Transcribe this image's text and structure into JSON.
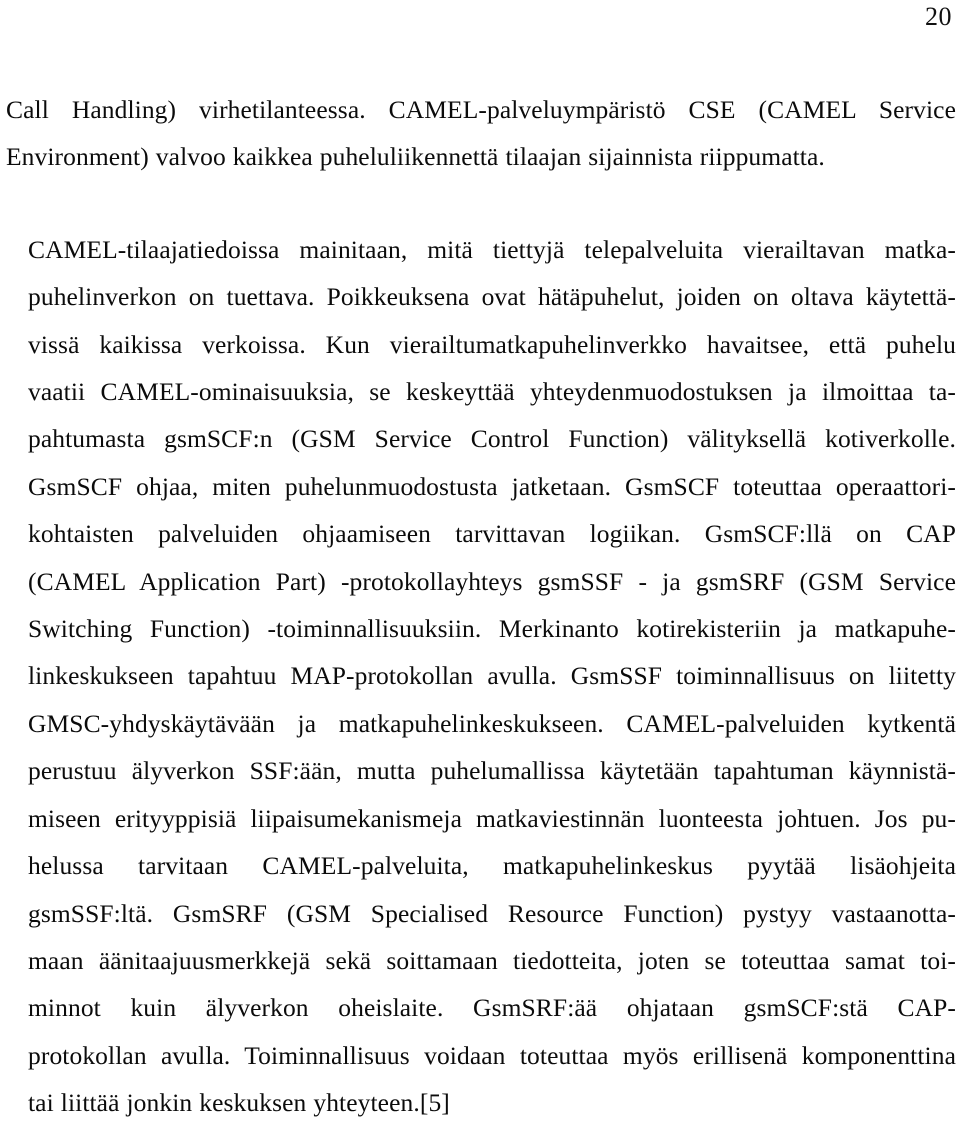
{
  "document": {
    "page_number": "20",
    "language": "fi",
    "paragraphs": [
      {
        "id": "para-1",
        "indented": false,
        "lines": [
          "Call Handling) virhetilanteessa. CAMEL-palveluympäristö CSE (CAMEL Service",
          "Environment) valvoo kaikkea puheluliikennettä tilaajan sijainnista riippumatta."
        ],
        "text": "Call Handling) virhetilanteessa. CAMEL-palveluympäristö CSE (CAMEL Service Environment) valvoo kaikkea puheluliikennettä tilaajan sijainnista riippumatta."
      },
      {
        "id": "para-2",
        "indented": true,
        "lines": [
          "CAMEL-tilaajatiedoissa mainitaan, mitä tiettyjä telepalveluita vierailtavan matka-",
          "puhelinverkon on tuettava. Poikkeuksena ovat hätäpuhelut, joiden on oltava käytettä-",
          "vissä kaikissa verkoissa. Kun vierailtumatkapuhelinverkko havaitsee, että puhelu",
          "vaatii CAMEL-ominaisuuksia, se keskeyttää yhteydenmuodostuksen ja ilmoittaa ta-",
          "pahtumasta gsmSCF:n (GSM Service Control Function) välityksellä kotiverkolle.",
          "GsmSCF ohjaa, miten puhelunmuodostusta jatketaan. GsmSCF toteuttaa operaattori-",
          "kohtaisten palveluiden ohjaamiseen tarvittavan logiikan. GsmSCF:llä on CAP",
          "(CAMEL Application Part) -protokollayhteys gsmSSF - ja gsmSRF (GSM Service",
          "Switching Function) -toiminnallisuuksiin. Merkinanto kotirekisteriin ja matkapuhe-",
          "linkeskukseen tapahtuu MAP-protokollan avulla. GsmSSF toiminnallisuus on liitetty",
          "GMSC-yhdyskäytävään ja matkapuhelinkeskukseen. CAMEL-palveluiden kytkentä",
          "perustuu älyverkon SSF:ään, mutta puhelumallissa käytetään tapahtuman käynnistä-",
          "miseen erityyppisiä liipaisumekanismeja matkaviestinnän luonteesta johtuen. Jos pu-",
          "helussa tarvitaan CAMEL-palveluita, matkapuhelinkeskus pyytää lisäohjeita",
          "gsmSSF:ltä. GsmSRF (GSM Specialised Resource Function) pystyy vastaanotta-",
          "maan äänitaajuusmerkkejä sekä soittamaan tiedotteita, joten se toteuttaa samat toi-",
          "minnot kuin älyverkon oheislaite. GsmSRF:ää ohjataan gsmSCF:stä CAP-",
          "protokollan avulla. Toiminnallisuus voidaan toteuttaa myös erillisenä komponenttina",
          "tai liittää jonkin keskuksen yhteyteen.[5]"
        ],
        "text": "CAMEL-tilaajatiedoissa mainitaan, mitä tiettyjä telepalveluita vierailtavan matkapuhelinverkon on tuettava. Poikkeuksena ovat hätäpuhelut, joiden on oltava käytettävissä kaikissa verkoissa. Kun vierailtumatkapuhelinverkko havaitsee, että puhelu vaatii CAMEL-ominaisuuksia, se keskeyttää yhteydenmuodostuksen ja ilmoittaa tapahtumasta gsmSCF:n (GSM Service Control Function) välityksellä kotiverkolle. GsmSCF ohjaa, miten puhelunmuodostusta jatketaan. GsmSCF toteuttaa operaattorikohtaisten palveluiden ohjaamiseen tarvittavan logiikan. GsmSCF:llä on CAP (CAMEL Application Part) -protokollayhteys gsmSSF - ja gsmSRF (GSM Service Switching Function) -toiminnallisuuksiin. Merkinanto kotirekisteriin ja matkapuhelinkeskukseen tapahtuu MAP-protokollan avulla. GsmSSF toiminnallisuus on liitetty GMSC-yhdyskäytävään ja matkapuhelinkeskukseen. CAMEL-palveluiden kytkentä perustuu älyverkon SSF:ään, mutta puhelumallissa käytetään tapahtuman käynnistämiseen erityyppisiä liipaisumekanismeja matkaviestinnän luonteesta johtuen. Jos puhelussa tarvitaan CAMEL-palveluita, matkapuhelinkeskus pyytää lisäohjeita gsmSSF:ltä. GsmSRF (GSM Specialised Resource Function) pystyy vastaanottamaan äänitaajuusmerkkejä sekä soittamaan tiedotteita, joten se toteuttaa samat toiminnot kuin älyverkon oheislaite. GsmSRF:ää ohjataan gsmSCF:stä CAP-protokollan avulla. Toiminnallisuus voidaan toteuttaa myös erillisenä komponenttina tai liittää jonkin keskuksen yhteyteen.[5]"
      }
    ],
    "citation": "[5]",
    "colors": {
      "page_background": "#ffffff",
      "text": "#0b0b0b"
    }
  }
}
